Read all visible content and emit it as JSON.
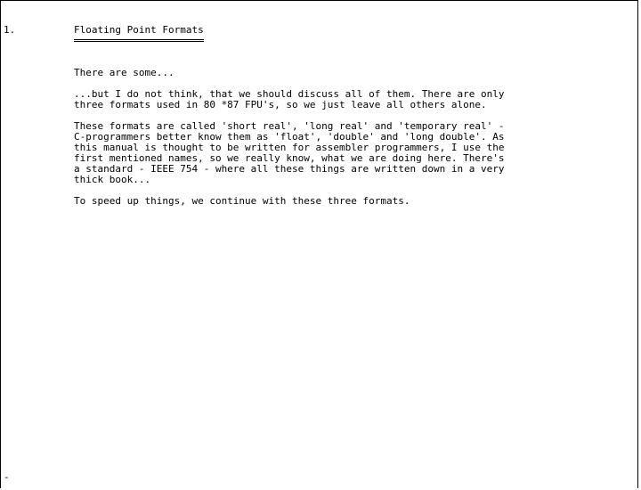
{
  "section": {
    "number": "1.",
    "title": "Floating Point Formats"
  },
  "paragraphs": [
    "There are some...",
    "...but I do not think, that we should discuss all of them. There are only\nthree formats used in 80 *87 FPU's, so we just leave all others alone.",
    "These formats are called 'short real', 'long real' and 'temporary real' -\nC-programmers better know them as 'float', 'double' and 'long double'. As\nthis manual is thought to be written for assembler programmers, I use the\nfirst mentioned names, so we really know, what we are doing here. There's\na standard - IEEE 754 - where all these things are written down in a very\nthick book...",
    "To speed up things, we continue with these three formats."
  ],
  "footer_mark": "-"
}
